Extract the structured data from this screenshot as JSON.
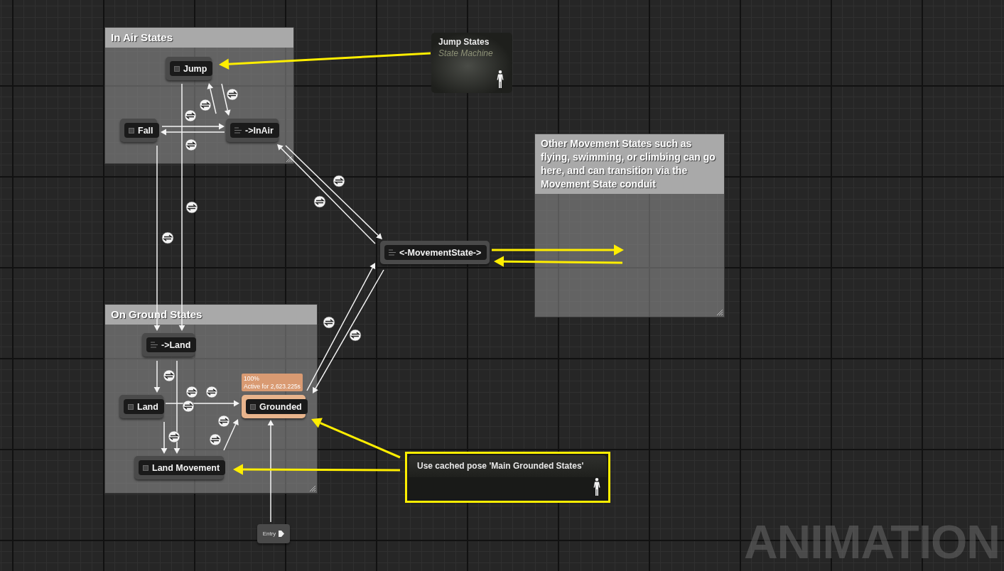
{
  "graph_label": "ANIMATION",
  "comments": [
    {
      "title": "In Air States"
    },
    {
      "title": "On Ground States"
    },
    {
      "title": "Other Movement States such as flying, swimming, or climbing can go here, and can transition via the Movement State conduit"
    }
  ],
  "nodes": [
    {
      "kind": "state",
      "name": "Jump",
      "active": false
    },
    {
      "kind": "state",
      "name": "Fall",
      "active": false
    },
    {
      "kind": "conduit",
      "name": "->InAir",
      "active": false
    },
    {
      "kind": "conduit",
      "name": "<-MovementState->",
      "active": false
    },
    {
      "kind": "conduit",
      "name": "->Land",
      "active": false
    },
    {
      "kind": "state",
      "name": "Land",
      "active": false
    },
    {
      "kind": "state",
      "name": "Grounded",
      "active": true,
      "tooltip": [
        "100%",
        "Active for 2,623.225s"
      ]
    },
    {
      "kind": "state",
      "name": "Land Movement",
      "active": false
    },
    {
      "kind": "entry",
      "name": "Entry",
      "active": false
    }
  ],
  "state_machine": {
    "title": "Jump States",
    "subtitle": "State Machine"
  },
  "cached_pose": {
    "title": "Use cached pose 'Main Grounded States'",
    "highlighted": true
  }
}
